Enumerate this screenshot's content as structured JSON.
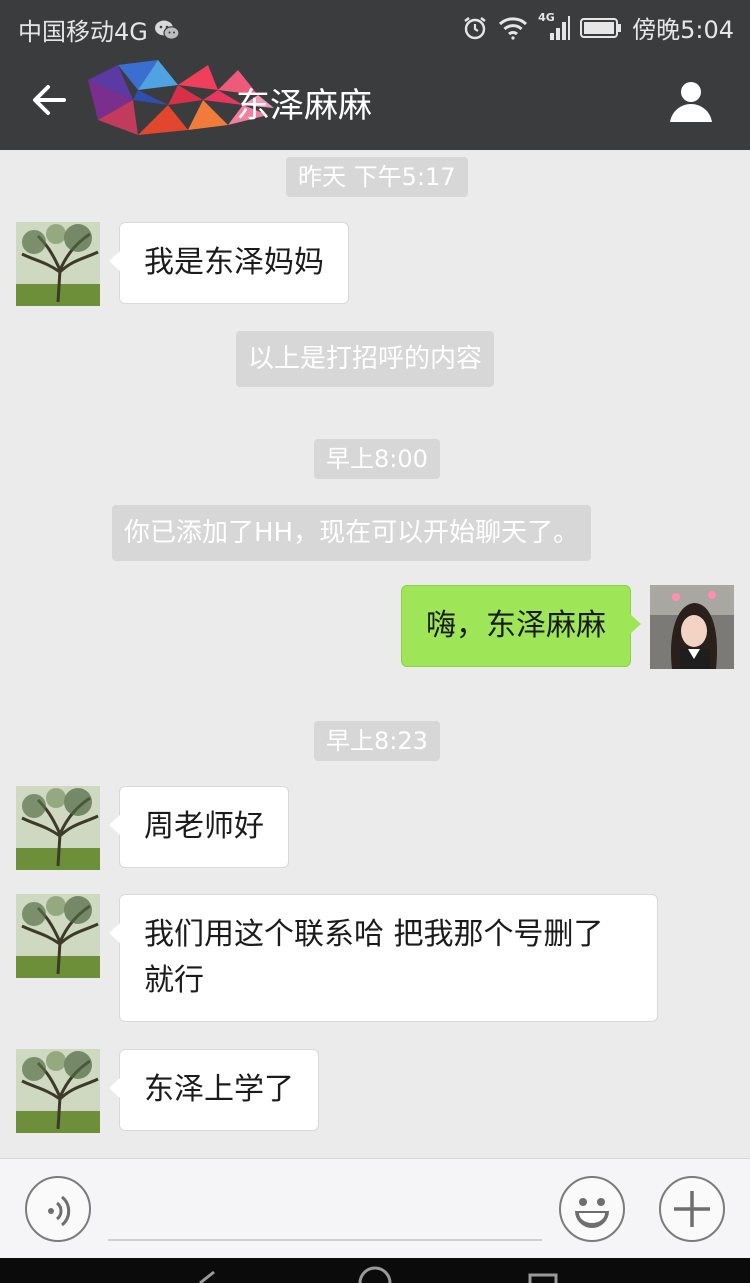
{
  "status_bar": {
    "carrier": "中国移动4G",
    "network_badge": "4G",
    "time": "傍晚5:04",
    "icons": [
      "wechat-icon",
      "alarm-icon",
      "wifi-icon",
      "signal-icon",
      "battery-icon"
    ]
  },
  "header": {
    "title": "东泽麻麻",
    "back_icon": "arrow-left-icon",
    "profile_icon": "person-icon"
  },
  "messages": [
    {
      "type": "time",
      "text": "昨天 下午5:17"
    },
    {
      "type": "incoming",
      "text": "我是东泽妈妈"
    },
    {
      "type": "system",
      "text": "以上是打招呼的内容"
    },
    {
      "type": "time",
      "text": "早上8:00"
    },
    {
      "type": "system",
      "text": "你已添加了HH，现在可以开始聊天了。"
    },
    {
      "type": "outgoing",
      "text": "嗨，东泽麻麻"
    },
    {
      "type": "time",
      "text": "早上8:23"
    },
    {
      "type": "incoming",
      "text": "周老师好"
    },
    {
      "type": "incoming",
      "text": "我们用这个联系哈 把我那个号删了就行"
    },
    {
      "type": "incoming",
      "text": "东泽上学了"
    }
  ],
  "input_bar": {
    "voice_icon": "voice-icon",
    "emoji_icon": "smiley-icon",
    "plus_icon": "plus-icon"
  },
  "colors": {
    "header_bg": "#3b3c3e",
    "chat_bg": "#ebebeb",
    "outgoing_bubble": "#9ee657",
    "incoming_bubble": "#ffffff"
  }
}
